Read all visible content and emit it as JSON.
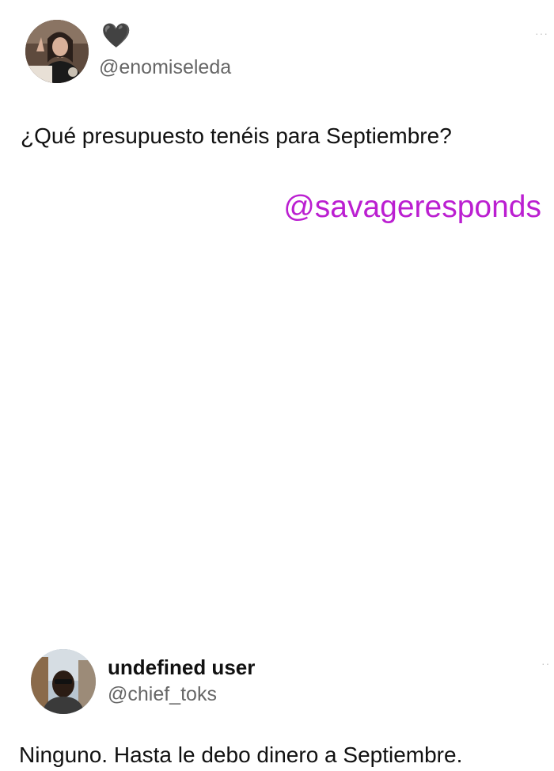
{
  "tweet_top": {
    "emoji": "🖤",
    "handle": "@enomiseleda",
    "text": "¿Qué presupuesto tenéis para Septiembre?",
    "more": "···"
  },
  "watermark": {
    "text": "@savageresponds",
    "color": "#bb1fd1"
  },
  "tweet_bottom": {
    "name": "undefined user",
    "handle": "@chief_toks",
    "text": "Ninguno. Hasta le debo dinero a Septiembre.",
    "more": "··"
  }
}
